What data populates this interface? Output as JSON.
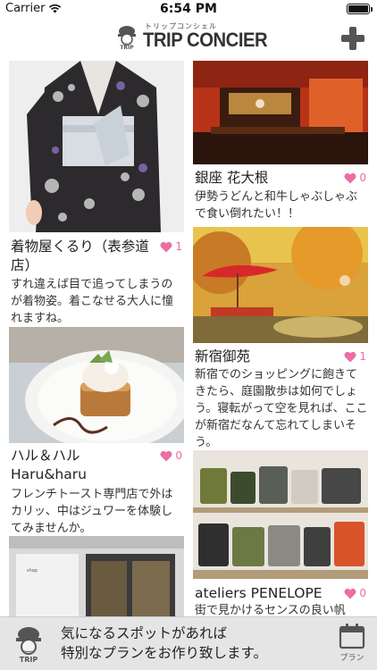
{
  "status_bar": {
    "carrier": "Carrier",
    "time": "6:54 PM"
  },
  "nav": {
    "logo_kana": "トリップコンシェル",
    "logo_text": "TRIP CONCIER",
    "logo_badge": "TRIP"
  },
  "cards": [
    {
      "title": "着物屋くるり（表参道店）",
      "desc": "すれ違えば目で追ってしまうのが着物姿。着こなせる大人に憧れますね。",
      "likes": "1",
      "image": "kimono-photo"
    },
    {
      "title": "銀座 花大根",
      "desc": "伊勢うどんと和牛しゃぶしゃぶで食い倒れたい！！",
      "likes": "0",
      "image": "restaurant-photo"
    },
    {
      "title": "ハル＆ハル\nHaru&haru",
      "desc": "フレンチトースト専門店で外はカリッ、中はジュワーを体験してみませんか。",
      "likes": "0",
      "image": "french-toast-photo"
    },
    {
      "title": "新宿御苑",
      "desc": "新宿でのショッピングに飽きてきたら、庭園散歩は如何でしょう。寝転がって空を見れば、ここが新宿だなんて忘れてしまいそう。",
      "likes": "1",
      "image": "garden-photo"
    },
    {
      "title": "ateliers PENELOPE",
      "desc": "街で見かけるセンスの良い帆",
      "likes": "0",
      "image": "bags-photo"
    },
    {
      "title": "",
      "desc": "",
      "likes": "",
      "image": "storefront-photo"
    }
  ],
  "banner": {
    "line1": "気になるスポットがあれば",
    "line2": "特別なプランをお作り致します。",
    "plan_label": "プラン",
    "logo_badge": "TRIP"
  },
  "colors": {
    "heart": "#ec6ea4",
    "banner_bg": "#e5e5e5"
  }
}
